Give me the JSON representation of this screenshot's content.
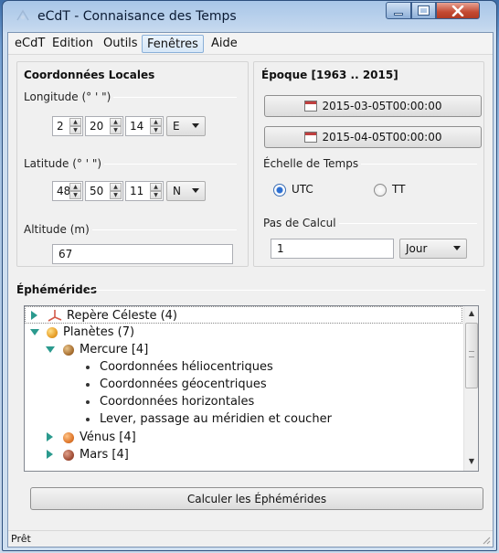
{
  "window": {
    "title": "eCdT - Connaisance des Temps"
  },
  "menu": [
    "eCdT",
    "Edition",
    "Outils",
    "Fenêtres",
    "Aide"
  ],
  "coordonnees": {
    "title": "Coordonnées Locales",
    "longitude": {
      "label": "Longitude (° ' \")",
      "deg": "2",
      "min": "20",
      "sec": "14",
      "dir": "E"
    },
    "latitude": {
      "label": "Latitude (° ' \")",
      "deg": "48",
      "min": "50",
      "sec": "11",
      "dir": "N"
    },
    "altitude": {
      "label": "Altitude (m)",
      "value": "67"
    }
  },
  "epoque": {
    "title": "Époque [1963 .. 2015]",
    "start": "2015-03-05T00:00:00",
    "end": "2015-04-05T00:00:00",
    "echelle_label": "Échelle de Temps",
    "utc_label": "UTC",
    "tt_label": "TT",
    "selected": "UTC",
    "pas_label": "Pas de Calcul",
    "pas_value": "1",
    "pas_unit": "Jour"
  },
  "ephemerides": {
    "title": "Éphémérides",
    "tree": {
      "repere": "Repère Céleste (4)",
      "planetes": "Planètes (7)",
      "mercure": "Mercure [4]",
      "mercure_children": [
        "Coordonnées héliocentriques",
        "Coordonnées géocentriques",
        "Coordonnées horizontales",
        "Lever, passage au méridien et coucher"
      ],
      "venus": "Vénus [4]",
      "mars": "Mars [4]"
    }
  },
  "actions": {
    "calculer": "Calculer les Éphémérides"
  },
  "status": "Prêt",
  "colors": {
    "tree_arrow": "#2b9a8e",
    "titlebar": "#a8c6e8",
    "close_button": "#c34a33"
  }
}
